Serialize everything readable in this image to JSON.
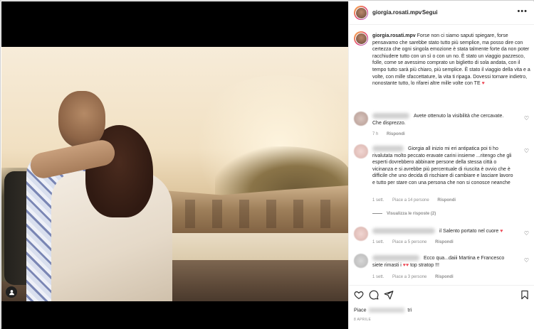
{
  "post": {
    "username": "giorgia.rosati.mpv",
    "follow_separator": "•",
    "follow_label": "Segui",
    "more_label": "•••",
    "caption_text": "Forse non ci siamo saputi spiegare, forse pensavamo che sarebbe stato tutto più semplice, ma posso dire con certezza che ogni singola emozione è stata talmente forte da non poter racchiudere tutto con un sì o con un no. È stato un viaggio pazzesco, folle, come se avessimo comprato un biglietto di sola andata, con il tempo tutto sarà più chiaro, più semplice. È stato il viaggio della vita e a volte, con mille sfaccettature, la vita ti ripaga. Dovessi tornare indietro, nonostante tutto, lo rifarei altre mille volte con TE"
  },
  "comments": [
    {
      "text": "Avete ottenuto la visibilità che cercavate. Che disprezzo.",
      "time": "7 h",
      "likes": "",
      "reply_label": "Rispondi"
    },
    {
      "text": "Giorgia all inizio mi eri antipatica poi ti ho rivalutata molto peccato eravate carini insieme ...ritengo che gli esperti dovrebbero abbinare persone della stessa città o vicinanza e si avrebbe più percentuale di riuscita è ovvio che è difficile che uno decida di rischiare di cambiare e lasciare lavoro e tutto per stare con una persona che non si conosce neanche",
      "time": "1 sett.",
      "likes": "Piace a 14 persone",
      "reply_label": "Rispondi",
      "view_replies": "Visualizza le risposte (2)"
    },
    {
      "text": "il Salento portato nel cuore",
      "time": "1 sett.",
      "likes": "Piace a 5 persone",
      "reply_label": "Rispondi"
    },
    {
      "text": "Ecco qua...daiii Martina e Francesco siete rimasti i",
      "text_tail": "top stratop !!!",
      "time": "1 sett.",
      "likes": "Piace a 3 persone",
      "reply_label": "Rispondi"
    }
  ],
  "footer": {
    "likes_prefix": "Piace",
    "likes_suffix": "tri",
    "date": "8 APRILE"
  },
  "icons": {
    "heart": "heart-icon",
    "comment": "comment-icon",
    "share": "share-icon",
    "save": "bookmark-icon",
    "tag": "person-tag-icon"
  },
  "colors": {
    "text": "#262626",
    "muted": "#8e8e8e",
    "heart_red": "#ed4956",
    "border": "#efefef"
  }
}
